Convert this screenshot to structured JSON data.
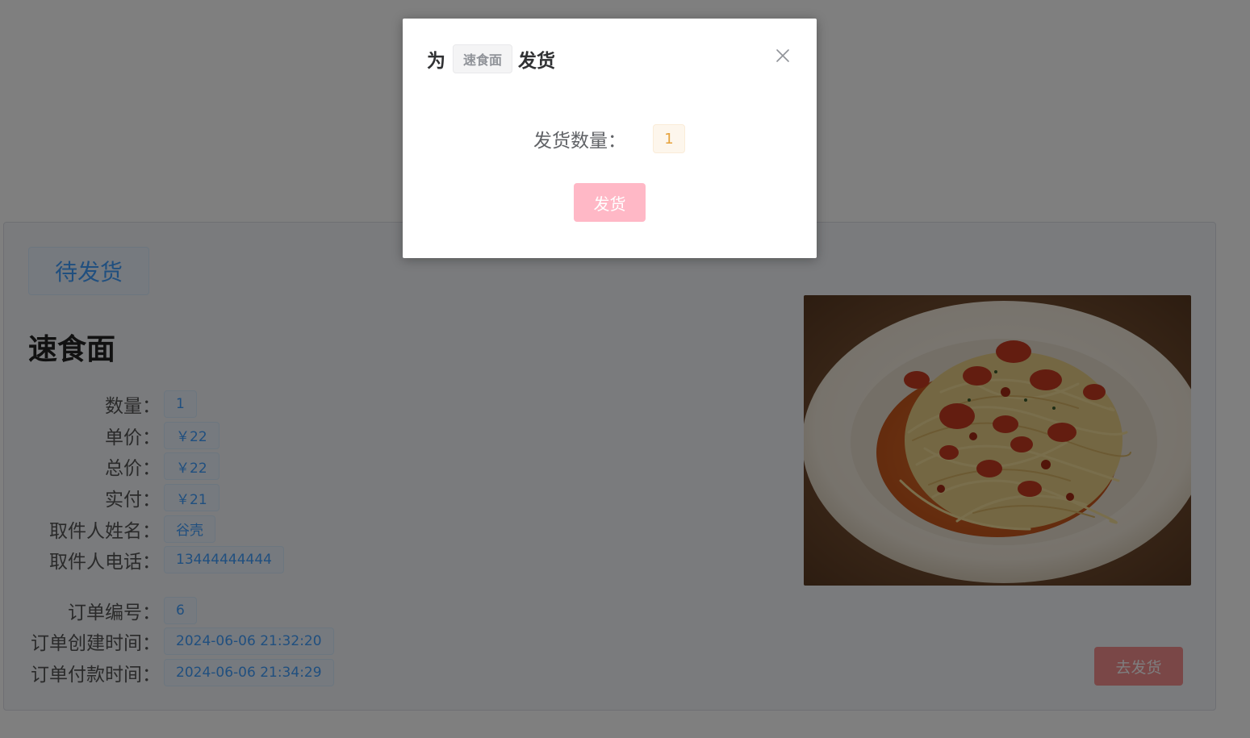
{
  "order": {
    "status": "待发货",
    "product_name": "速食面",
    "fields": [
      {
        "label": "数量：",
        "value": "1"
      },
      {
        "label": "单价：",
        "value": "￥22"
      },
      {
        "label": "总价：",
        "value": "￥22"
      },
      {
        "label": "实付：",
        "value": "￥21"
      },
      {
        "label": "取件人姓名：",
        "value": "谷壳"
      },
      {
        "label": "取件人电话：",
        "value": "13444444444"
      },
      {
        "label": "订单编号：",
        "value": "6"
      },
      {
        "label": "订单创建时间：",
        "value": "2024-06-06 21:32:20"
      },
      {
        "label": "订单付款时间：",
        "value": "2024-06-06 21:34:29"
      }
    ],
    "action_button": "去发货"
  },
  "dialog": {
    "title_prefix": "为",
    "title_tag": "速食面",
    "title_suffix": "发货",
    "quantity_label": "发货数量：",
    "quantity_value": "1",
    "submit_button": "发货",
    "close_icon": "close-icon"
  },
  "colors": {
    "primary": "#409eff",
    "warning": "#e6a23c",
    "danger": "#f56c6c",
    "ship_button": "#ffb8c6",
    "overlay": "rgba(0,0,0,0.5)"
  }
}
